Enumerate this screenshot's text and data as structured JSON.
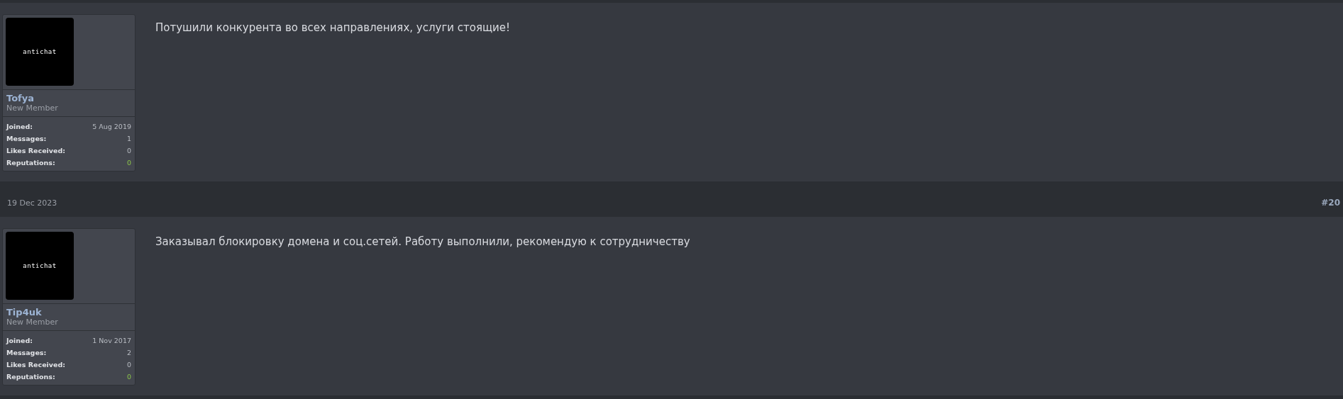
{
  "posts": [
    {
      "user": {
        "avatar_text": "antichat",
        "name": "Tofya",
        "title": "New Member",
        "stats": [
          {
            "label": "Joined:",
            "value": "5 Aug 2019",
            "kind": "plain"
          },
          {
            "label": "Messages:",
            "value": "1",
            "kind": "plain"
          },
          {
            "label": "Likes Received:",
            "value": "0",
            "kind": "plain"
          },
          {
            "label": "Reputations:",
            "value": "0",
            "kind": "reputation"
          }
        ]
      },
      "message": "Потушили конкурента во всех направлениях, услуги стоящие!"
    },
    {
      "date": "19 Dec 2023",
      "number": "#20",
      "user": {
        "avatar_text": "antichat",
        "name": "Tip4uk",
        "title": "New Member",
        "stats": [
          {
            "label": "Joined:",
            "value": "1 Nov 2017",
            "kind": "plain"
          },
          {
            "label": "Messages:",
            "value": "2",
            "kind": "plain"
          },
          {
            "label": "Likes Received:",
            "value": "0",
            "kind": "plain"
          },
          {
            "label": "Reputations:",
            "value": "0",
            "kind": "reputation"
          }
        ]
      },
      "message": "Заказывал блокировку домена и соц.сетей. Работу выполнили, рекомендую к сотрудничеству"
    }
  ]
}
